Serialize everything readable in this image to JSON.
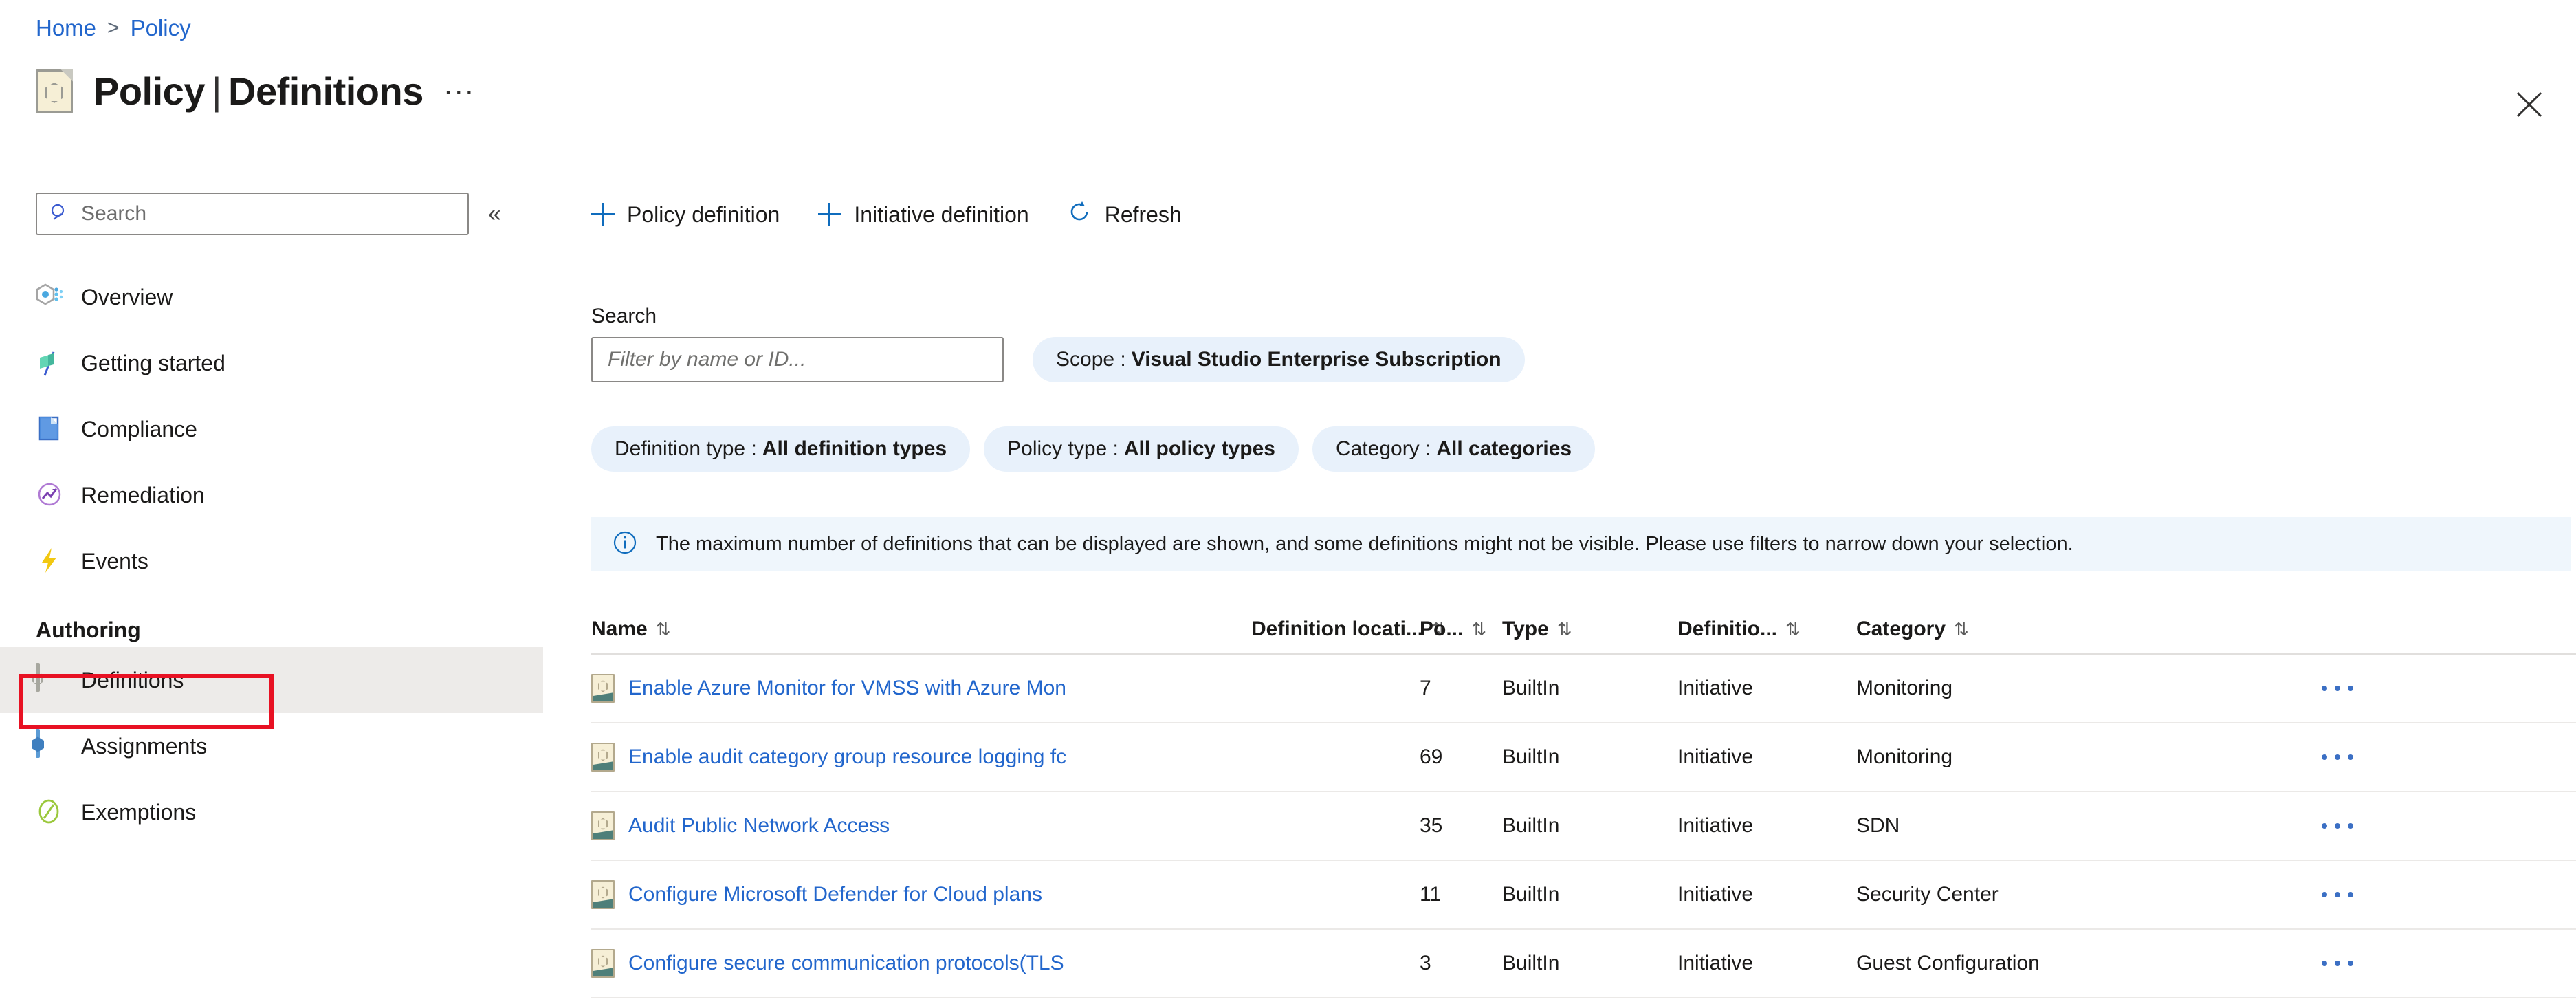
{
  "breadcrumb": {
    "home": "Home",
    "separator": ">",
    "current": "Policy"
  },
  "header": {
    "title_main": "Policy",
    "title_divider": "|",
    "title_sub": "Definitions",
    "more_ellipsis": "...",
    "close_label": "Close"
  },
  "sidebar": {
    "search_placeholder": "Search",
    "collapse_label": "«",
    "items": [
      {
        "label": "Overview",
        "icon": "overview-hex-icon",
        "selected": false
      },
      {
        "label": "Getting started",
        "icon": "flag-icon",
        "selected": false
      },
      {
        "label": "Compliance",
        "icon": "compliance-doc-icon",
        "selected": false
      },
      {
        "label": "Remediation",
        "icon": "remediation-chart-icon",
        "selected": false
      },
      {
        "label": "Events",
        "icon": "lightning-bolt-icon",
        "selected": false
      }
    ],
    "section_authoring": "Authoring",
    "authoring_items": [
      {
        "label": "Definitions",
        "icon": "definitions-doc-icon",
        "selected": true
      },
      {
        "label": "Assignments",
        "icon": "assignments-doc-icon",
        "selected": false
      },
      {
        "label": "Exemptions",
        "icon": "exemptions-slash-icon",
        "selected": false
      }
    ]
  },
  "toolbar": {
    "policy_definition": "Policy definition",
    "initiative_definition": "Initiative definition",
    "refresh": "Refresh"
  },
  "filters": {
    "search_label": "Search",
    "search_placeholder": "Filter by name or ID...",
    "scope_key": "Scope :",
    "scope_value": "Visual Studio Enterprise Subscription",
    "definition_type_key": "Definition type :",
    "definition_type_value": "All definition types",
    "policy_type_key": "Policy type :",
    "policy_type_value": "All policy types",
    "category_key": "Category :",
    "category_value": "All categories"
  },
  "banner": {
    "icon": "info-circle-icon",
    "text": "The maximum number of definitions that can be displayed are shown, and some definitions might not be visible. Please use filters to narrow down your selection."
  },
  "table": {
    "columns": {
      "name": "Name",
      "definition_location": "Definition locati...",
      "policies": "Po...",
      "type": "Type",
      "definition_type": "Definitio...",
      "category": "Category"
    },
    "sort_glyph": "⇅",
    "row_menu": "...",
    "rows": [
      {
        "name": "Enable Azure Monitor for VMSS with Azure Mon",
        "definition_location": "",
        "policies": "7",
        "type": "BuiltIn",
        "definition_type": "Initiative",
        "category": "Monitoring"
      },
      {
        "name": "Enable audit category group resource logging fc",
        "definition_location": "",
        "policies": "69",
        "type": "BuiltIn",
        "definition_type": "Initiative",
        "category": "Monitoring"
      },
      {
        "name": "Audit Public Network Access",
        "definition_location": "",
        "policies": "35",
        "type": "BuiltIn",
        "definition_type": "Initiative",
        "category": "SDN"
      },
      {
        "name": "Configure Microsoft Defender for Cloud plans",
        "definition_location": "",
        "policies": "11",
        "type": "BuiltIn",
        "definition_type": "Initiative",
        "category": "Security Center"
      },
      {
        "name": "Configure secure communication protocols(TLS",
        "definition_location": "",
        "policies": "3",
        "type": "BuiltIn",
        "definition_type": "Initiative",
        "category": "Guest Configuration"
      }
    ]
  },
  "colors": {
    "link_blue": "#2266cc",
    "accent_blue": "#0f6cbd",
    "pill_bg": "#e8f1fb",
    "banner_bg": "#eff6fc",
    "selected_bg": "#edebe9",
    "annotation_red": "#e81123"
  }
}
